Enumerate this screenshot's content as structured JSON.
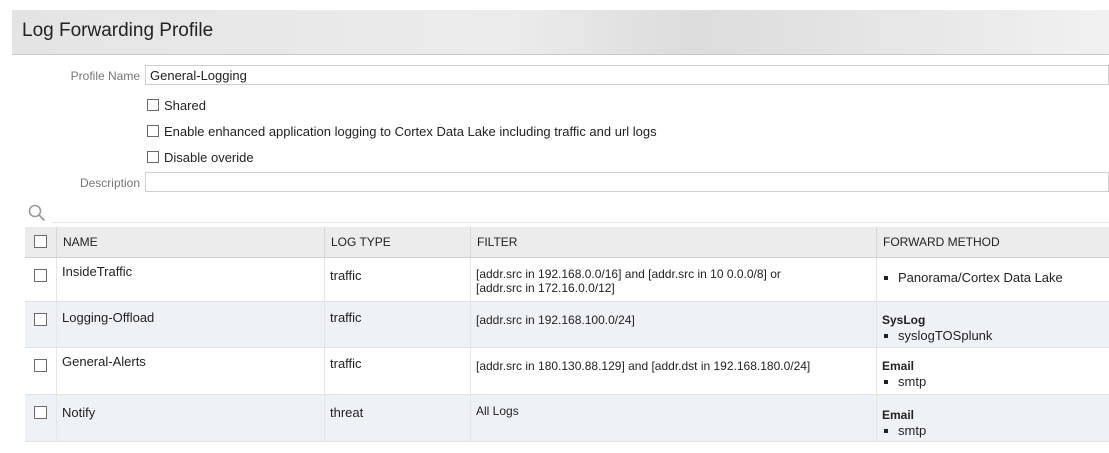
{
  "header": {
    "title": "Log Forwarding Profile"
  },
  "form": {
    "profile_name_label": "Profile Name",
    "profile_name_value": "General-Logging",
    "shared_label": "Shared",
    "cortex_label": "Enable enhanced application logging to Cortex Data Lake including traffic and url logs",
    "disable_override_label": "Disable overide",
    "description_label": "Description",
    "description_value": ""
  },
  "table": {
    "columns": {
      "name": "NAME",
      "log_type": "LOG TYPE",
      "filter": "FILTER",
      "forward_method": "FORWARD METHOD"
    },
    "rows": [
      {
        "name": "InsideTraffic",
        "log_type": "traffic",
        "filter_line1": "[addr.src in 192.168.0.0/16] and [addr.src in 10 0.0.0/8] or",
        "filter_line2": "[addr.src in 172.16.0.0/12]",
        "method_title": "",
        "method_item": "Panorama/Cortex Data Lake"
      },
      {
        "name": "Logging-Offload",
        "log_type": "traffic",
        "filter_line1": "[addr.src in 192.168.100.0/24]",
        "filter_line2": "",
        "method_title": "SysLog",
        "method_item": "syslogTOSplunk"
      },
      {
        "name": "General-Alerts",
        "log_type": "traffic",
        "filter_line1": "[addr.src in 180.130.88.129] and [addr.dst in 192.168.180.0/24]",
        "filter_line2": "",
        "method_title": "Email",
        "method_item": "smtp"
      },
      {
        "name": "Notify",
        "log_type": "threat",
        "filter_line1": "All Logs",
        "filter_line2": "",
        "method_title": "Email",
        "method_item": "smtp"
      }
    ]
  },
  "icons": {
    "search": "search-icon",
    "checkbox": "checkbox-icon"
  },
  "colors": {
    "header_bg": "#e6e6e6",
    "alt_row_bg": "#eef2f7",
    "table_header_bg": "#ececec"
  }
}
